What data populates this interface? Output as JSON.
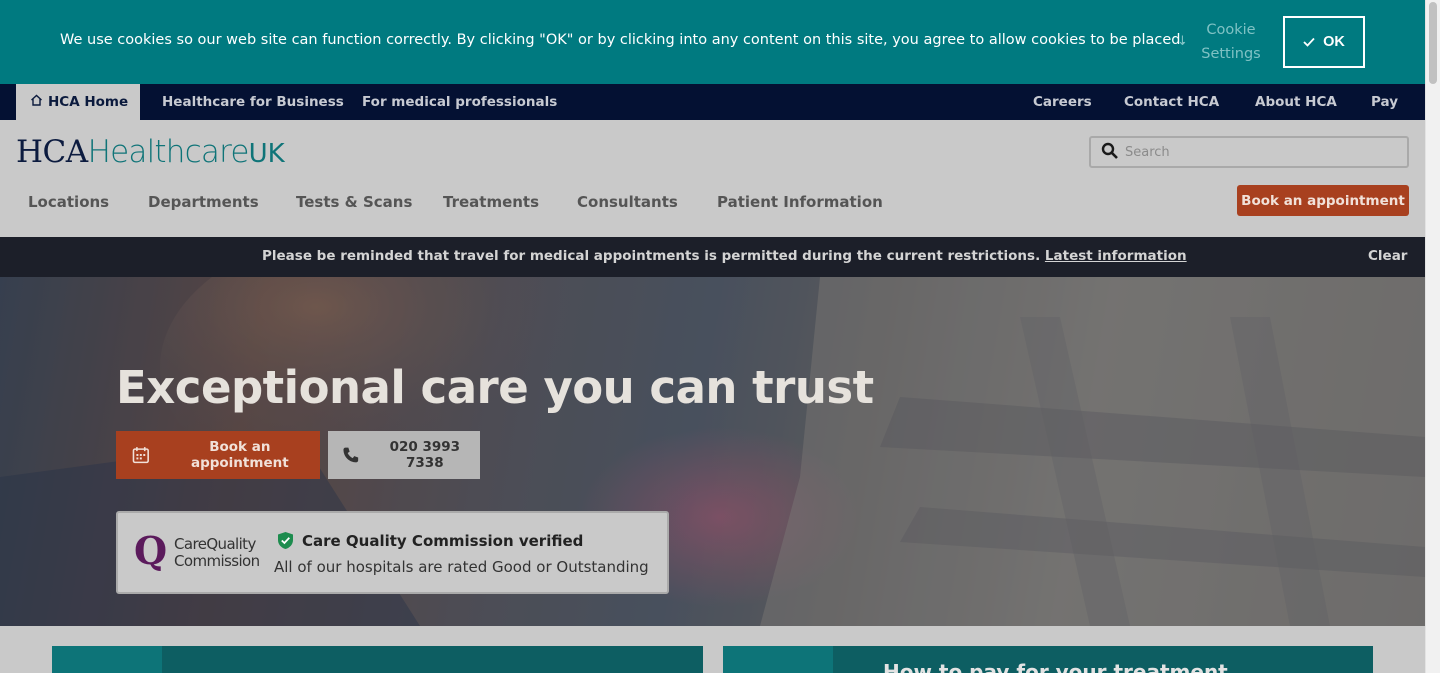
{
  "cookie": {
    "message": "We use cookies so our web site can function correctly. By clicking \"OK\" or by clicking into any content on this site, you agree to allow cookies to be placed.",
    "settings_label_1": "Cookie",
    "settings_label_2": "Settings",
    "ok_label": "OK"
  },
  "utility_nav": {
    "left": [
      "HCA Home",
      "Healthcare for Business",
      "For medical professionals"
    ],
    "right": [
      "Careers",
      "Contact HCA",
      "About HCA",
      "Pay"
    ]
  },
  "header": {
    "logo_hca": "HCA",
    "logo_healthcare": "Healthcare",
    "logo_uk": "UK",
    "search_placeholder": "Search",
    "book_label": "Book an appointment"
  },
  "main_nav": [
    "Locations",
    "Departments",
    "Tests & Scans",
    "Treatments",
    "Consultants",
    "Patient Information"
  ],
  "notice": {
    "text": "Please be reminded that travel for medical appointments is permitted during the current restrictions. ",
    "link": "Latest information",
    "clear": "Clear"
  },
  "hero": {
    "title": "Exceptional care you can trust",
    "book_label": "Book an appointment",
    "phone": "020 3993 7338",
    "cqc_logo_1": "CareQuality",
    "cqc_logo_2": "Commission",
    "cqc_title": "Care Quality Commission verified",
    "cqc_sub": "All of our hospitals are rated Good or Outstanding"
  },
  "cards": {
    "right_title": "How to pay for your treatment"
  },
  "colors": {
    "teal": "#007a80",
    "navy": "#041133",
    "brand_orange": "#a8401f",
    "cqc_purple": "#5b1a5c",
    "check_green": "#1d8c4e"
  }
}
